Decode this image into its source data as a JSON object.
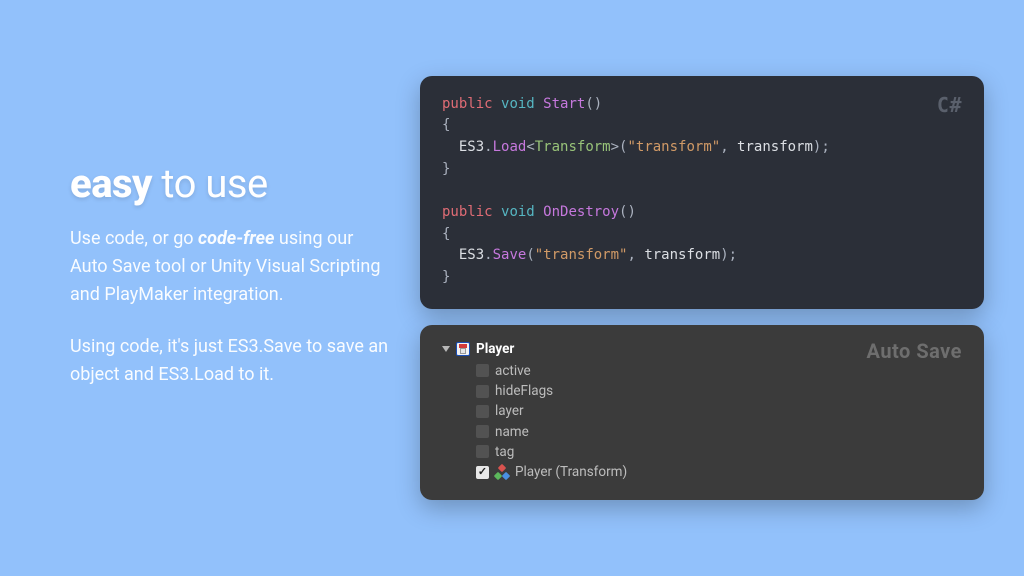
{
  "headline": {
    "bold": "easy",
    "rest": " to use"
  },
  "para1_pre": "Use code, or go ",
  "para1_em": "code-free",
  "para1_post": " using our Auto Save tool or Unity Visual Scripting and PlayMaker integration.",
  "para2": "Using code, it's just ES3.Save to save an object and ES3.Load to it.",
  "code_panel": {
    "label": "C#",
    "fn1": {
      "kw_public": "public",
      "kw_void": "void",
      "name": "Start",
      "call_obj": "ES3",
      "call_fn": "Load",
      "generic": "Transform",
      "arg_str": "\"transform\"",
      "arg_id": "transform"
    },
    "fn2": {
      "kw_public": "public",
      "kw_void": "void",
      "name": "OnDestroy",
      "call_obj": "ES3",
      "call_fn": "Save",
      "arg_str": "\"transform\"",
      "arg_id": "transform"
    }
  },
  "autosave_panel": {
    "label": "Auto Save",
    "root": "Player",
    "rows": [
      {
        "label": "active",
        "checked": false
      },
      {
        "label": "hideFlags",
        "checked": false
      },
      {
        "label": "layer",
        "checked": false
      },
      {
        "label": "name",
        "checked": false
      },
      {
        "label": "tag",
        "checked": false
      },
      {
        "label": "Player (Transform)",
        "checked": true,
        "icon": "transform"
      }
    ]
  }
}
